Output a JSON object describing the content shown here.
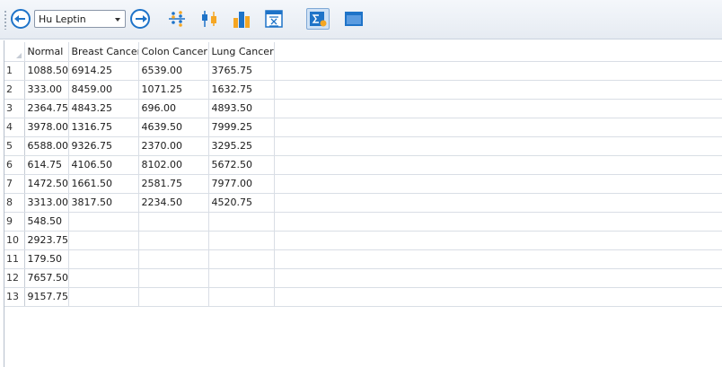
{
  "toolbar": {
    "dataset_select": {
      "value": "Hu Leptin"
    },
    "icons": [
      "back-arrow-icon",
      "forward-arrow-icon",
      "dot-plot-icon",
      "box-plot-icon",
      "bar-chart-icon",
      "summary-table-icon",
      "descriptive-statistics-icon",
      "window-icon"
    ],
    "colors": {
      "accent": "#1e73c8",
      "bar_orange": "#f5a623",
      "active_bg": "#cfe1f5"
    }
  },
  "grid": {
    "columns": [
      "Normal",
      "Breast Cancer",
      "Colon Cancer",
      "Lung Cancer"
    ],
    "rows": [
      {
        "num": "1",
        "cells": [
          "1088.50",
          "6914.25",
          "6539.00",
          "3765.75"
        ]
      },
      {
        "num": "2",
        "cells": [
          "333.00",
          "8459.00",
          "1071.25",
          "1632.75"
        ]
      },
      {
        "num": "3",
        "cells": [
          "2364.75",
          "4843.25",
          "696.00",
          "4893.50"
        ]
      },
      {
        "num": "4",
        "cells": [
          "3978.00",
          "1316.75",
          "4639.50",
          "7999.25"
        ]
      },
      {
        "num": "5",
        "cells": [
          "6588.00",
          "9326.75",
          "2370.00",
          "3295.25"
        ]
      },
      {
        "num": "6",
        "cells": [
          "614.75",
          "4106.50",
          "8102.00",
          "5672.50"
        ]
      },
      {
        "num": "7",
        "cells": [
          "1472.50",
          "1661.50",
          "2581.75",
          "7977.00"
        ]
      },
      {
        "num": "8",
        "cells": [
          "3313.00",
          "3817.50",
          "2234.50",
          "4520.75"
        ]
      },
      {
        "num": "9",
        "cells": [
          "548.50",
          "",
          "",
          ""
        ]
      },
      {
        "num": "10",
        "cells": [
          "2923.75",
          "",
          "",
          ""
        ]
      },
      {
        "num": "11",
        "cells": [
          "179.50",
          "",
          "",
          ""
        ]
      },
      {
        "num": "12",
        "cells": [
          "7657.50",
          "",
          "",
          ""
        ]
      },
      {
        "num": "13",
        "cells": [
          "9157.75",
          "",
          "",
          ""
        ]
      }
    ]
  }
}
